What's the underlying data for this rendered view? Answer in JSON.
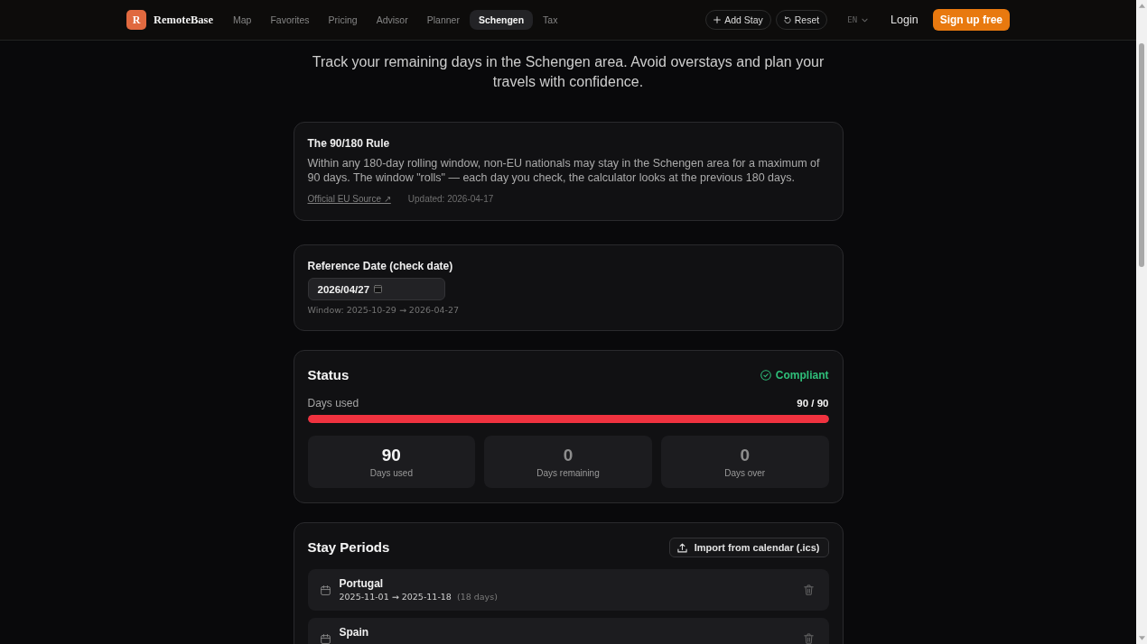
{
  "header": {
    "logo": {
      "letter": "R",
      "name": "RemoteBase"
    },
    "nav": [
      {
        "label": "Map",
        "selected": false
      },
      {
        "label": "Favorites",
        "selected": false
      },
      {
        "label": "Pricing",
        "selected": false
      },
      {
        "label": "Advisor",
        "selected": false
      },
      {
        "label": "Planner",
        "selected": false
      },
      {
        "label": "Schengen",
        "selected": true
      },
      {
        "label": "Tax",
        "selected": false
      }
    ],
    "actions": [
      {
        "label": "Add Stay",
        "kind": "add"
      },
      {
        "label": "Reset",
        "kind": "reset"
      }
    ],
    "language": "EN",
    "login": "Login",
    "signup": "Sign up free"
  },
  "intro": "Track your remaining days in the Schengen area. Avoid overstays and plan your travels with confidence.",
  "rule_card": {
    "title": "The 90/180 Rule",
    "text": "Within any 180-day rolling window, non-EU nationals may stay in the Schengen area for a maximum of 90 days. The window \"rolls\" — each day you check, the calculator looks at the previous 180 days.",
    "source_link": "Official EU Source ↗",
    "updated": "Updated: 2026-04-17"
  },
  "reference_card": {
    "label": "Reference Date (check date)",
    "date_value": "2026/04/27",
    "window": "Window: 2025-10-29 → 2026-04-27"
  },
  "status_card": {
    "title": "Status",
    "status": {
      "label": "Compliant",
      "kind": "compliant"
    },
    "progress": {
      "label": "Days used",
      "reading": "90 / 90",
      "level": 1
    },
    "stats": [
      {
        "value": "90",
        "label": "Days used",
        "muted": false
      },
      {
        "value": "0",
        "label": "Days remaining",
        "muted": true
      },
      {
        "value": "0",
        "label": "Days over",
        "muted": true
      }
    ]
  },
  "stays_card": {
    "title": "Stay Periods",
    "import_button": "Import from calendar (.ics)",
    "stays": [
      {
        "country": "Portugal",
        "dates": "2025-11-01 → 2025-11-18",
        "duration": "(18 days)"
      },
      {
        "country": "Spain"
      }
    ]
  }
}
